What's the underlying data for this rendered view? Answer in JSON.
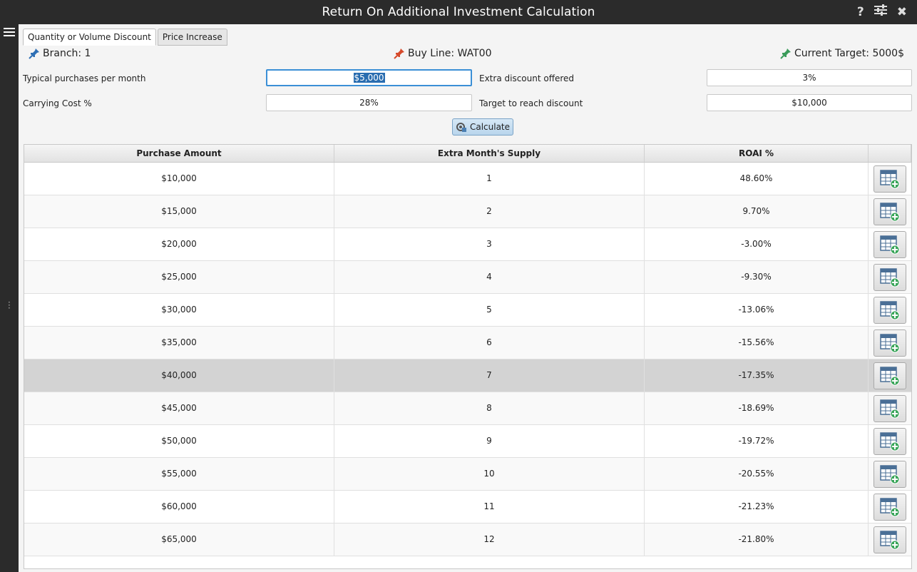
{
  "window": {
    "title": "Return On Additional Investment Calculation",
    "help_glyph": "?",
    "settings_glyph": "☰",
    "close_glyph": "✖"
  },
  "tabs": [
    {
      "label": "Quantity or Volume Discount",
      "active": true
    },
    {
      "label": "Price Increase",
      "active": false
    }
  ],
  "info": {
    "branch": "Branch: 1",
    "buy_line": "Buy Line: WAT00",
    "current_target": "Current Target: 5000$"
  },
  "form": {
    "typical_label": "Typical purchases per month",
    "typical_value": "$5,000",
    "carrying_label": "Carrying Cost %",
    "carrying_value": "28%",
    "extra_discount_label": "Extra discount offered",
    "extra_discount_value": "3%",
    "target_label": "Target to reach discount",
    "target_value": "$10,000",
    "calculate_label": "Calculate"
  },
  "table": {
    "headers": [
      "Purchase Amount",
      "Extra Month's Supply",
      "ROAI %",
      ""
    ],
    "selected_row": 6,
    "rows": [
      [
        "$10,000",
        "1",
        "48.60%"
      ],
      [
        "$15,000",
        "2",
        "9.70%"
      ],
      [
        "$20,000",
        "3",
        "-3.00%"
      ],
      [
        "$25,000",
        "4",
        "-9.30%"
      ],
      [
        "$30,000",
        "5",
        "-13.06%"
      ],
      [
        "$35,000",
        "6",
        "-15.56%"
      ],
      [
        "$40,000",
        "7",
        "-17.35%"
      ],
      [
        "$45,000",
        "8",
        "-18.69%"
      ],
      [
        "$50,000",
        "9",
        "-19.72%"
      ],
      [
        "$55,000",
        "10",
        "-20.55%"
      ],
      [
        "$60,000",
        "11",
        "-21.23%"
      ],
      [
        "$65,000",
        "12",
        "-21.80%"
      ]
    ]
  },
  "colors": {
    "pin_blue": "#2e6fb5",
    "pin_red": "#d64a2b",
    "pin_green": "#3a9b5a",
    "titlebar": "#2b2b2b",
    "selected_row": "#d3d3d3"
  }
}
